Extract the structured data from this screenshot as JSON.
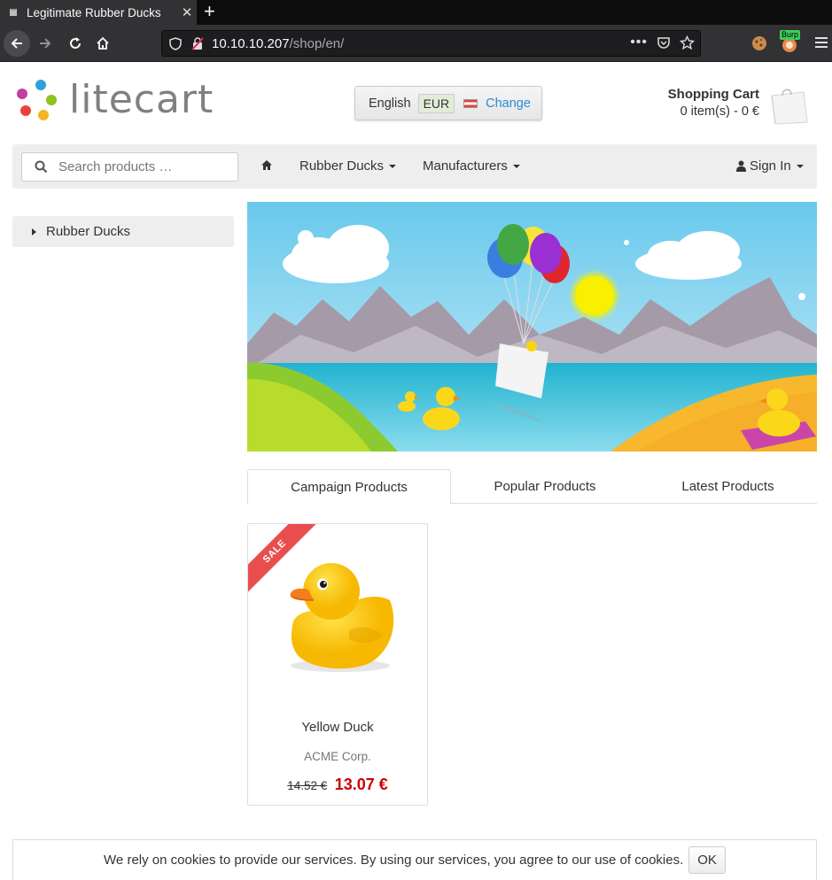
{
  "browser": {
    "tab_title": "Legitimate Rubber Ducks",
    "url_host": "10.10.10.207",
    "url_path": "/shop/en/",
    "extension_badge": "Burp"
  },
  "header": {
    "logo_text": "litecart",
    "language": "English",
    "currency": "EUR",
    "change_label": "Change",
    "cart_title": "Shopping Cart",
    "cart_summary": "0 item(s) - 0 €"
  },
  "nav": {
    "search_placeholder": "Search products …",
    "items": [
      "Rubber Ducks",
      "Manufacturers"
    ],
    "sign_in": "Sign In"
  },
  "sidebar": {
    "categories": [
      "Rubber Ducks"
    ]
  },
  "tabs": [
    "Campaign Products",
    "Popular Products",
    "Latest Products"
  ],
  "product": {
    "badge": "SALE",
    "name": "Yellow Duck",
    "manufacturer": "ACME Corp.",
    "old_price": "14.52 €",
    "price": "13.07 €"
  },
  "cookie": {
    "message": "We rely on cookies to provide our services. By using our services, you agree to our use of cookies.",
    "ok": "OK"
  },
  "colors": {
    "accent_link": "#2a8bd3",
    "sale_red": "#e94e4e",
    "price_red": "#cc0000"
  }
}
